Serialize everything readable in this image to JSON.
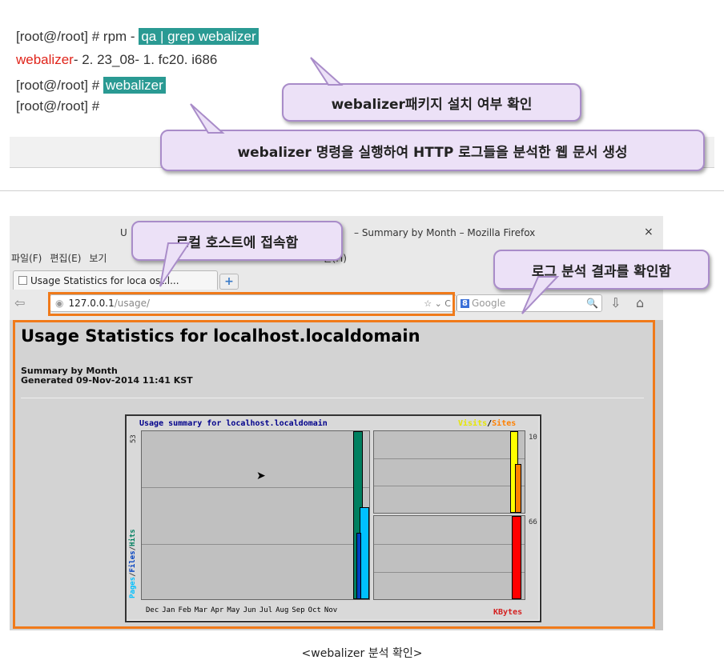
{
  "terminal": {
    "line1_prompt": "[root@/root] # rpm -",
    "line1_hl": "qa | grep webalizer",
    "line2_name": "webalizer",
    "line2_version": "- 2. 23_08- 1. fc20. i686",
    "line3_prompt": "[root@/root] #",
    "line3_hl": "webalizer",
    "line4_prompt": "[root@/root] #"
  },
  "callouts": {
    "check_package": "webalizer패키지 설치 여부 확인",
    "run_webalizer": "webalizer 명령을 실행하여 HTTP 로그들을 분석한 웹 문서 생성",
    "connect_local": "로컬 호스트에 접속함",
    "check_result": "로그 분석 결과를 확인함"
  },
  "browser": {
    "title_prefix": "U",
    "title": "– Summary by Month – Mozilla Firefox",
    "close": "×",
    "menu": [
      "파일(F)",
      "편집(E)",
      "보기",
      "말(H)"
    ],
    "tab_label": "Usage Statistics for loca ost.l...",
    "new_tab": "+",
    "back_icon": "⇦",
    "url_host": "127.0.0.1",
    "url_path": "/usage/",
    "url_icons": "☆ ⌄ C",
    "search_engine": "8",
    "search_placeholder": "Google",
    "search_icon": "🔍",
    "download_icon": "⇩",
    "home_icon": "⌂"
  },
  "page": {
    "heading": "Usage Statistics for localhost.localdomain",
    "summary": "Summary by Month",
    "generated": "Generated 09-Nov-2014 11:41 KST"
  },
  "chart_data": {
    "type": "bar",
    "title": "Usage summary for localhost.localdomain",
    "categories": [
      "Dec",
      "Jan",
      "Feb",
      "Mar",
      "Apr",
      "May",
      "Jun",
      "Jul",
      "Aug",
      "Sep",
      "Oct",
      "Nov"
    ],
    "left_y_max_label": "53",
    "left_legend": [
      "Pages",
      "/",
      "Files",
      "/",
      "Hits"
    ],
    "right_top_legend": [
      "Visits",
      "/",
      "Sites"
    ],
    "right_top_max_label": "10",
    "right_bottom_max_label": "66",
    "right_bottom_label": "KBytes",
    "series": [
      {
        "name": "Hits",
        "color": "#008060",
        "values": [
          0,
          0,
          0,
          0,
          0,
          0,
          0,
          0,
          0,
          0,
          0,
          53
        ]
      },
      {
        "name": "Files",
        "color": "#00c0ff",
        "values": [
          0,
          0,
          0,
          0,
          0,
          0,
          0,
          0,
          0,
          0,
          0,
          29
        ]
      },
      {
        "name": "Pages",
        "color": "#0040c0",
        "values": [
          0,
          0,
          0,
          0,
          0,
          0,
          0,
          0,
          0,
          0,
          0,
          21
        ]
      },
      {
        "name": "Visits",
        "color": "#ffff00",
        "values": [
          0,
          0,
          0,
          0,
          0,
          0,
          0,
          0,
          0,
          0,
          0,
          10
        ]
      },
      {
        "name": "Sites",
        "color": "#ff8000",
        "values": [
          0,
          0,
          0,
          0,
          0,
          0,
          0,
          0,
          0,
          0,
          0,
          6
        ]
      },
      {
        "name": "KBytes",
        "color": "#ff0000",
        "values": [
          0,
          0,
          0,
          0,
          0,
          0,
          0,
          0,
          0,
          0,
          0,
          66
        ]
      }
    ]
  },
  "caption": "<webalizer 분석 확인>",
  "colors": {
    "accent_teal": "#2a9a93",
    "orange_box": "#f07a1a",
    "callout_fill": "#ece1f7",
    "callout_border": "#a98cc9"
  }
}
